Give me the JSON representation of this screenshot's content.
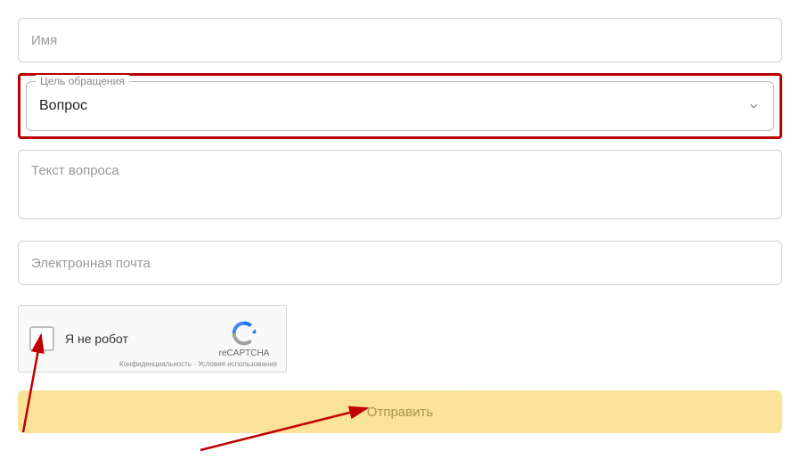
{
  "form": {
    "name_placeholder": "Имя",
    "purpose": {
      "label": "Цель обращения",
      "selected": "Вопрос"
    },
    "question_placeholder": "Текст вопроса",
    "email_placeholder": "Электронная почта",
    "recaptcha": {
      "label": "Я не робот",
      "brand": "reCAPTCHA",
      "terms": "Конфиденциальность - Условия использования"
    },
    "submit_label": "Отправить"
  }
}
